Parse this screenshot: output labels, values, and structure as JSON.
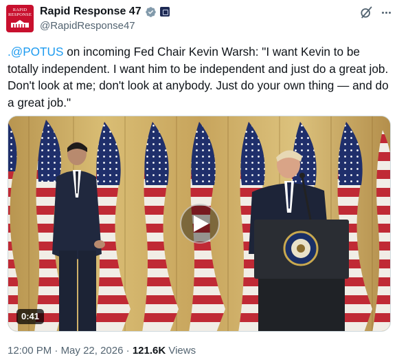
{
  "author": {
    "display_name": "Rapid Response 47",
    "handle": "@RapidResponse47",
    "avatar_text": "RAPID\nRESPONSE",
    "verified_color": "#829aab",
    "avatar_color": "#c8102e"
  },
  "header": {
    "grok_icon": "grok-icon",
    "more_icon": "more-icon"
  },
  "tweet": {
    "mention": ".@POTUS",
    "body": " on incoming Fed Chair Kevin Warsh: \"I want Kevin to be totally independent. I want him to be independent and just do a great job. Don't look at me; don't look at anybody. Just do your own thing — and do a great job.\""
  },
  "media": {
    "type": "video",
    "duration": "0:41",
    "play_icon": "play-icon",
    "podium_seal_text": "PRESIDENT OF THE UNITED STATES"
  },
  "meta": {
    "time": "12:00 PM",
    "separator": " · ",
    "date": "May 22, 2026",
    "views_count": "121.6K",
    "views_label": " Views"
  },
  "colors": {
    "link": "#1d9bf0",
    "secondary_text": "#536471",
    "primary_text": "#0f1419"
  }
}
